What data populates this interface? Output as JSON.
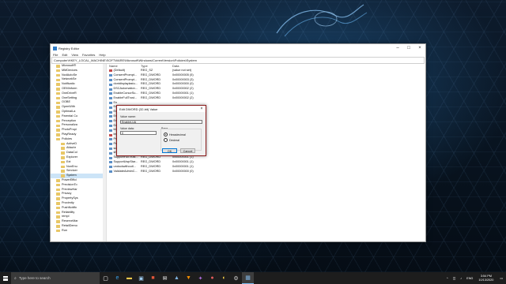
{
  "window": {
    "title": "Registry Editor",
    "menu": [
      "File",
      "Edit",
      "View",
      "Favorites",
      "Help"
    ],
    "address": "Computer\\HKEY_LOCAL_MACHINE\\SOFTWARE\\Microsoft\\Windows\\CurrentVersion\\Policies\\System"
  },
  "tree": {
    "items": [
      {
        "label": "Microsoft®",
        "selected": false
      },
      {
        "label": "MMDevices",
        "selected": false
      },
      {
        "label": "NcdAutoSe",
        "selected": false
      },
      {
        "label": "NetworkSe",
        "selected": false
      },
      {
        "label": "Notificatio",
        "selected": false
      },
      {
        "label": "OEMInform",
        "selected": false
      },
      {
        "label": "OneDriveR",
        "selected": false
      },
      {
        "label": "OneSetting",
        "selected": false
      },
      {
        "label": "OOBE",
        "selected": false
      },
      {
        "label": "OpenWith",
        "selected": false
      },
      {
        "label": "OptimalLa",
        "selected": false
      },
      {
        "label": "Parental Co",
        "selected": false
      },
      {
        "label": "Perception",
        "selected": false
      },
      {
        "label": "Personaliza",
        "selected": false
      },
      {
        "label": "PhotoPropi",
        "selected": false
      },
      {
        "label": "PlayReady",
        "selected": false
      },
      {
        "label": "Policies",
        "selected": false
      },
      {
        "label": "ActiveD",
        "selected": false
      },
      {
        "label": "Attachr",
        "selected": false
      },
      {
        "label": "DataCol",
        "selected": false
      },
      {
        "label": "Explorer",
        "selected": false
      },
      {
        "label": "Ext",
        "selected": false
      },
      {
        "label": "NonEnu",
        "selected": false
      },
      {
        "label": "Servicer",
        "selected": false
      },
      {
        "label": "System",
        "selected": true
      },
      {
        "label": "PowerEffici",
        "selected": false
      },
      {
        "label": "PrecisionTo",
        "selected": false
      },
      {
        "label": "PreviewHar",
        "selected": false
      },
      {
        "label": "Privacy",
        "selected": false
      },
      {
        "label": "PropertySys",
        "selected": false
      },
      {
        "label": "Proximity",
        "selected": false
      },
      {
        "label": "PushNotific",
        "selected": false
      },
      {
        "label": "Reliability",
        "selected": false
      },
      {
        "label": "rempl",
        "selected": false
      },
      {
        "label": "ReserveMar",
        "selected": false
      },
      {
        "label": "RetailDemo",
        "selected": false
      },
      {
        "label": "Run",
        "selected": false
      }
    ]
  },
  "list": {
    "headers": {
      "name": "Name",
      "type": "Type",
      "data": "Data"
    },
    "rows": [
      {
        "name": "(Default)",
        "type": "REG_SZ",
        "data": "(value not set)",
        "icon": "string-value-icon"
      },
      {
        "name": "ConsentPrompt...",
        "type": "REG_DWORD",
        "data": "0x00000005 (5)",
        "icon": "dword-value-icon"
      },
      {
        "name": "ConsentPrompt...",
        "type": "REG_DWORD",
        "data": "0x00000003 (3)",
        "icon": "dword-value-icon"
      },
      {
        "name": "dontdisplaylastu...",
        "type": "REG_DWORD",
        "data": "0x00000000 (0)",
        "icon": "dword-value-icon"
      },
      {
        "name": "DSCAutomation...",
        "type": "REG_DWORD",
        "data": "0x00000002 (2)",
        "icon": "dword-value-icon"
      },
      {
        "name": "EnableCursorSu...",
        "type": "REG_DWORD",
        "data": "0x00000001 (1)",
        "icon": "dword-value-icon"
      },
      {
        "name": "EnableFullTrust...",
        "type": "REG_DWORD",
        "data": "0x00000002 (2)",
        "icon": "dword-value-icon"
      },
      {
        "name": "En",
        "type": "",
        "data": "",
        "icon": "dword-value-icon"
      },
      {
        "name": "En",
        "type": "",
        "data": "",
        "icon": "dword-value-icon"
      },
      {
        "name": "En",
        "type": "",
        "data": "",
        "icon": "dword-value-icon"
      },
      {
        "name": "En",
        "type": "",
        "data": "",
        "icon": "dword-value-icon"
      },
      {
        "name": "En",
        "type": "",
        "data": "",
        "icon": "dword-value-icon"
      },
      {
        "name": "En",
        "type": "",
        "data": "",
        "icon": "dword-value-icon"
      },
      {
        "name": "leg",
        "type": "",
        "data": "",
        "icon": "dword-value-icon"
      },
      {
        "name": "leg",
        "type": "",
        "data": "",
        "icon": "string-value-icon"
      },
      {
        "name": "Pro",
        "type": "",
        "data": "",
        "icon": "dword-value-icon"
      },
      {
        "name": "Pro",
        "type": "",
        "data": "",
        "icon": "dword-value-icon"
      },
      {
        "name": "scforceoption",
        "type": "REG_DWORD",
        "data": "0x00000000 (0)",
        "icon": "dword-value-icon"
      },
      {
        "name": "shutdownwithou...",
        "type": "REG_DWORD",
        "data": "0x00000001 (1)",
        "icon": "dword-value-icon"
      },
      {
        "name": "SupportFullTrust...",
        "type": "REG_DWORD",
        "data": "0x00000001 (1)",
        "icon": "dword-value-icon"
      },
      {
        "name": "SupportUwpStar...",
        "type": "REG_DWORD",
        "data": "0x00000001 (1)",
        "icon": "dword-value-icon"
      },
      {
        "name": "undockwithoutl...",
        "type": "REG_DWORD",
        "data": "0x00000001 (1)",
        "icon": "dword-value-icon"
      },
      {
        "name": "ValidateAdminC...",
        "type": "REG_DWORD",
        "data": "0x00000000 (0)",
        "icon": "dword-value-icon"
      }
    ]
  },
  "dialog": {
    "title": "Edit DWORD (32-bit) Value",
    "value_name_label": "Value name:",
    "value_name": "EnableLUA",
    "value_data_label": "Value data:",
    "value_data": "0",
    "base_label": "Base",
    "hex_label": "Hexadecimal",
    "dec_label": "Decimal",
    "selected_base": "Hexadecimal",
    "ok_label": "OK",
    "cancel_label": "Cancel"
  },
  "taskbar": {
    "search_placeholder": "Type here to search",
    "icons": [
      "task-view-icon",
      "edge-icon",
      "file-explorer-icon",
      "store-icon",
      "office-icon",
      "mail-icon",
      "photos-icon",
      "vlc-icon",
      "app-icon",
      "app-icon-2",
      "app-icon-3",
      "settings-icon",
      "media-icon"
    ],
    "lang": "ENG",
    "time": "3:54 PM",
    "date": "10/13/2020"
  }
}
